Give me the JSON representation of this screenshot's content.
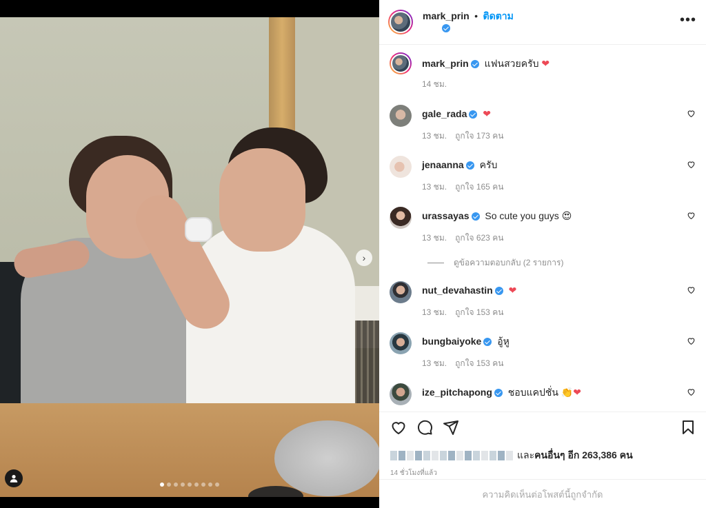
{
  "post": {
    "author": "mark_prin",
    "follow_label": "ติดตาม",
    "separator": "•",
    "more_label": "•••"
  },
  "caption": {
    "username": "mark_prin",
    "text": "แฟนสวยครับ",
    "emoji": "❤",
    "time": "14 ชม."
  },
  "comments": [
    {
      "username": "gale_rada",
      "text": "",
      "emoji": "❤",
      "time": "13 ชม.",
      "likes": "ถูกใจ 173 คน",
      "verified": true
    },
    {
      "username": "jenaanna",
      "text": "ครับ",
      "emoji": "",
      "time": "13 ชม.",
      "likes": "ถูกใจ 165 คน",
      "verified": true
    },
    {
      "username": "urassayas",
      "text": "So cute you guys",
      "emoji": "😍",
      "time": "13 ชม.",
      "likes": "ถูกใจ 623 คน",
      "verified": true
    },
    {
      "username": "nut_devahastin",
      "text": "",
      "emoji": "❤",
      "time": "13 ชม.",
      "likes": "ถูกใจ 153 คน",
      "verified": true
    },
    {
      "username": "bungbaiyoke",
      "text": "อู้หู",
      "emoji": "",
      "time": "13 ชม.",
      "likes": "ถูกใจ 153 คน",
      "verified": true
    },
    {
      "username": "ize_pitchapong",
      "text": "ชอบแคปชั่น",
      "emoji": "👏❤",
      "time": "",
      "likes": "",
      "verified": true
    }
  ],
  "view_replies": "ดูข้อความตอบกลับ (2 รายการ)",
  "likes_summary": {
    "prefix": "และ",
    "text": "คนอื่นๆ อีก 263,386 คน"
  },
  "post_time": "14 ชั่วโมงที่แล้ว",
  "comments_limited": "ความคิดเห็นต่อโพสต์นี้ถูกจำกัด",
  "carousel": {
    "count": 9,
    "active_index": 0
  },
  "colors": {
    "accent": "#0095f6",
    "verified": "#3897f0",
    "heart": "#ed4956"
  }
}
